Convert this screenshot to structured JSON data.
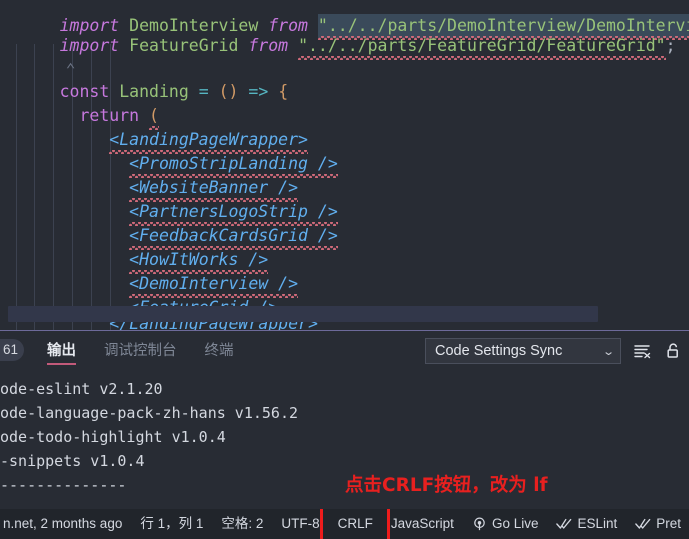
{
  "editor": {
    "lines": [
      {
        "id": "l-import-demo",
        "text": "import DemoInterview from \"../../parts/DemoInterview/DemoInterview\";"
      },
      {
        "id": "l-import-fg",
        "text": "import FeatureGrid from \"../../parts/FeatureGrid/FeatureGrid\";"
      },
      {
        "id": "l-const",
        "text": "const Landing = () => {"
      },
      {
        "id": "l-return",
        "text": "  return ("
      },
      {
        "id": "l-wrapper-open",
        "text": "    <LandingPageWrapper>"
      },
      {
        "id": "l-promo",
        "text": "      <PromoStripLanding />"
      },
      {
        "id": "l-banner",
        "text": "      <WebsiteBanner />"
      },
      {
        "id": "l-partners",
        "text": "      <PartnersLogoStrip />"
      },
      {
        "id": "l-feedback",
        "text": "      <FeedbackCardsGrid />"
      },
      {
        "id": "l-how",
        "text": "      <HowItWorks />"
      },
      {
        "id": "l-demo",
        "text": "      <DemoInterview />"
      },
      {
        "id": "l-featuregrid",
        "text": "      <FeatureGrid />"
      },
      {
        "id": "l-wrapper-close",
        "text": "    </LandingPageWrapper>"
      },
      {
        "id": "l-close-paren",
        "text": "  );"
      }
    ],
    "tokens": {
      "kw_import": "import",
      "kw_from": "from",
      "kw_const": "const",
      "kw_return": "return",
      "name_demo": "DemoInterview",
      "name_fg": "FeatureGrid",
      "name_landing": "Landing",
      "str_demo": "\"../../parts/DemoInterview/DemoInterview\"",
      "str_fg": "\"../../parts/FeatureGrid/FeatureGrid\"",
      "eq": "=",
      "arrow": "=>",
      "parens": "()",
      "brace_open": "{",
      "paren_open": "(",
      "paren_close": ");",
      "semi": ";",
      "tag_wrapper_open": "<LandingPageWrapper>",
      "tag_wrapper_close": "</LandingPageWrapper>",
      "tag_promo": "<PromoStripLanding />",
      "tag_banner": "<WebsiteBanner />",
      "tag_partners": "<PartnersLogoStrip />",
      "tag_feedback": "<FeedbackCardsGrid />",
      "tag_how": "<HowItWorks />",
      "tag_demo": "<DemoInterview />",
      "tag_featuregrid": "<FeatureGrid />"
    }
  },
  "panel": {
    "badge": "61",
    "tabs": [
      {
        "id": "tab-output",
        "label": "输出",
        "active": true
      },
      {
        "id": "tab-debug-console",
        "label": "调试控制台",
        "active": false
      },
      {
        "id": "tab-terminal",
        "label": "终端",
        "active": false
      }
    ],
    "channel_select": {
      "value": "Code Settings Sync",
      "chevron": "chevron-down-icon"
    },
    "icons": [
      {
        "id": "clear-output-icon",
        "name": "clear-output-icon"
      },
      {
        "id": "unlock-icon",
        "name": "unlock-icon"
      }
    ],
    "output_lines": [
      "ode-eslint v2.1.20",
      "ode-language-pack-zh-hans v1.56.2",
      "ode-todo-highlight v1.0.4",
      "-snippets v1.0.4",
      "--------------"
    ],
    "annotation": "点击CRLF按钮，改为 lf"
  },
  "statusbar": {
    "items": [
      {
        "id": "sb-git-blame",
        "label": "n.net, 2 months ago",
        "icon": ""
      },
      {
        "id": "sb-cursor-position",
        "label": "行 1，列 1",
        "icon": ""
      },
      {
        "id": "sb-indentation",
        "label": "空格: 2",
        "icon": ""
      },
      {
        "id": "sb-encoding",
        "label": "UTF-8",
        "icon": ""
      },
      {
        "id": "sb-eol",
        "label": "CRLF",
        "icon": ""
      },
      {
        "id": "sb-language-mode",
        "label": "JavaScript",
        "icon": ""
      },
      {
        "id": "sb-go-live",
        "label": "Go Live",
        "icon": "broadcast-icon"
      },
      {
        "id": "sb-eslint",
        "label": "ESLint",
        "icon": "check-all-icon"
      },
      {
        "id": "sb-prettier",
        "label": "Pret",
        "icon": "check-all-icon"
      }
    ],
    "highlight": "CRLF"
  },
  "colors": {
    "editor_bg": "#282c34",
    "panel_bg": "#282c34",
    "statusbar_bg": "#21252b",
    "annotation_red": "#e8201f",
    "highlight_red": "#ee1c1c",
    "tab_underline": "#c25a7a",
    "panel_border": "#6d6a9a"
  }
}
